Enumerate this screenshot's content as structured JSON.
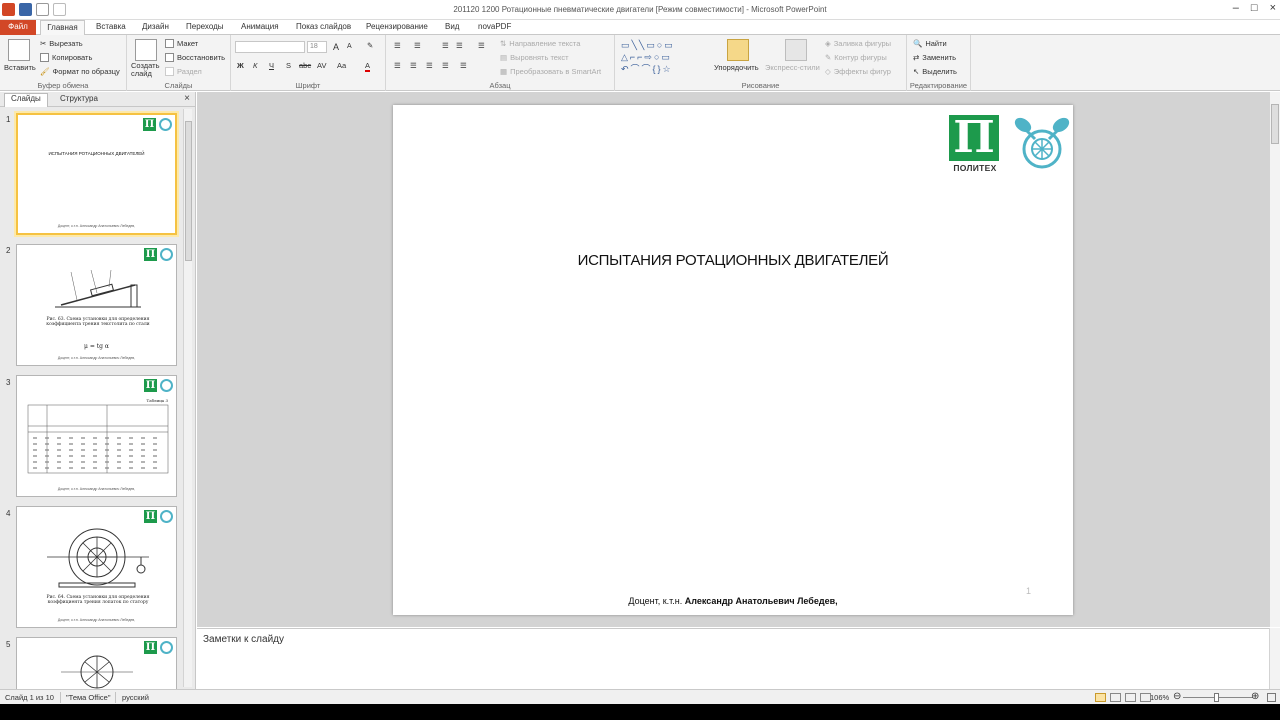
{
  "window": {
    "title": "201120 1200 Ротационные пневматические двигатели [Режим совместимости] - Microsoft PowerPoint",
    "controls": [
      "–",
      "□",
      "×"
    ]
  },
  "ribbon": {
    "tabs": [
      {
        "label": "Файл"
      },
      {
        "label": "Главная"
      },
      {
        "label": "Вставка"
      },
      {
        "label": "Дизайн"
      },
      {
        "label": "Переходы"
      },
      {
        "label": "Анимация"
      },
      {
        "label": "Показ слайдов"
      },
      {
        "label": "Рецензирование"
      },
      {
        "label": "Вид"
      },
      {
        "label": "novaPDF"
      }
    ],
    "clipboard": {
      "paste": "Вставить",
      "cut": "Вырезать",
      "copy": "Копировать",
      "format_painter": "Формат по образцу",
      "label": "Буфер обмена"
    },
    "slides": {
      "new_slide": "Создать слайд",
      "layout": "Макет",
      "reset": "Восстановить",
      "section": "Раздел",
      "label": "Слайды"
    },
    "font": {
      "size": "18",
      "label": "Шрифт",
      "bold": "Ж",
      "italic": "К",
      "underline": "Ч",
      "strike": "S",
      "abc": "abc",
      "spacing": "AV",
      "case": "Aa",
      "color": "A",
      "grow": "A",
      "shrink": "A"
    },
    "paragraph": {
      "text_direction": "Направление текста",
      "align_text": "Выровнять текст",
      "smartart": "Преобразовать в SmartArt",
      "label": "Абзац"
    },
    "drawing": {
      "arrange": "Упорядочить",
      "quick_styles": "Экспресс-стили",
      "fill": "Заливка фигуры",
      "outline": "Контур фигуры",
      "effects": "Эффекты фигур",
      "label": "Рисование"
    },
    "editing": {
      "find": "Найти",
      "replace": "Заменить",
      "select": "Выделить",
      "label": "Редактирование"
    }
  },
  "left_pane": {
    "tabs": [
      "Слайды",
      "Структура"
    ],
    "close": "×",
    "thumbnails": [
      {
        "number": "1",
        "title": "ИСПЫТАНИЯ РОТАЦИОННЫХ ДВИГАТЕЛЕЙ",
        "selected": true
      },
      {
        "number": "2",
        "caption": "Рис. 63. Схема установки для определения коэффициента трения текстолита по стали",
        "formula": "μ = tg α",
        "selected": false
      },
      {
        "number": "3",
        "caption": "Таблица 3",
        "selected": false
      },
      {
        "number": "4",
        "caption": "Рис. 64. Схема установки для определения коэффициента трения лопаток по статору",
        "selected": false
      },
      {
        "number": "5",
        "selected": false
      }
    ]
  },
  "slide": {
    "title": "ИСПЫТАНИЯ РОТАЦИОННЫХ ДВИГАТЕЛЕЙ",
    "footer_prefix": "Доцент, к.т.н. ",
    "footer_name": "Александр Анатольевич Лебедев,",
    "page_number": "1",
    "logo_caption": "ПОЛИТЕХ",
    "logo_letter": "П"
  },
  "notes": {
    "placeholder": "Заметки к слайду"
  },
  "status_bar": {
    "slide_info": "Слайд 1 из 10",
    "theme": "\"Тема Office\"",
    "language": "русский",
    "zoom": "106%"
  },
  "colors": {
    "file_tab": "#d24726",
    "logo_green": "#1d9a4c",
    "logo_blue": "#4fb3c7",
    "selection": "#f5c242"
  }
}
